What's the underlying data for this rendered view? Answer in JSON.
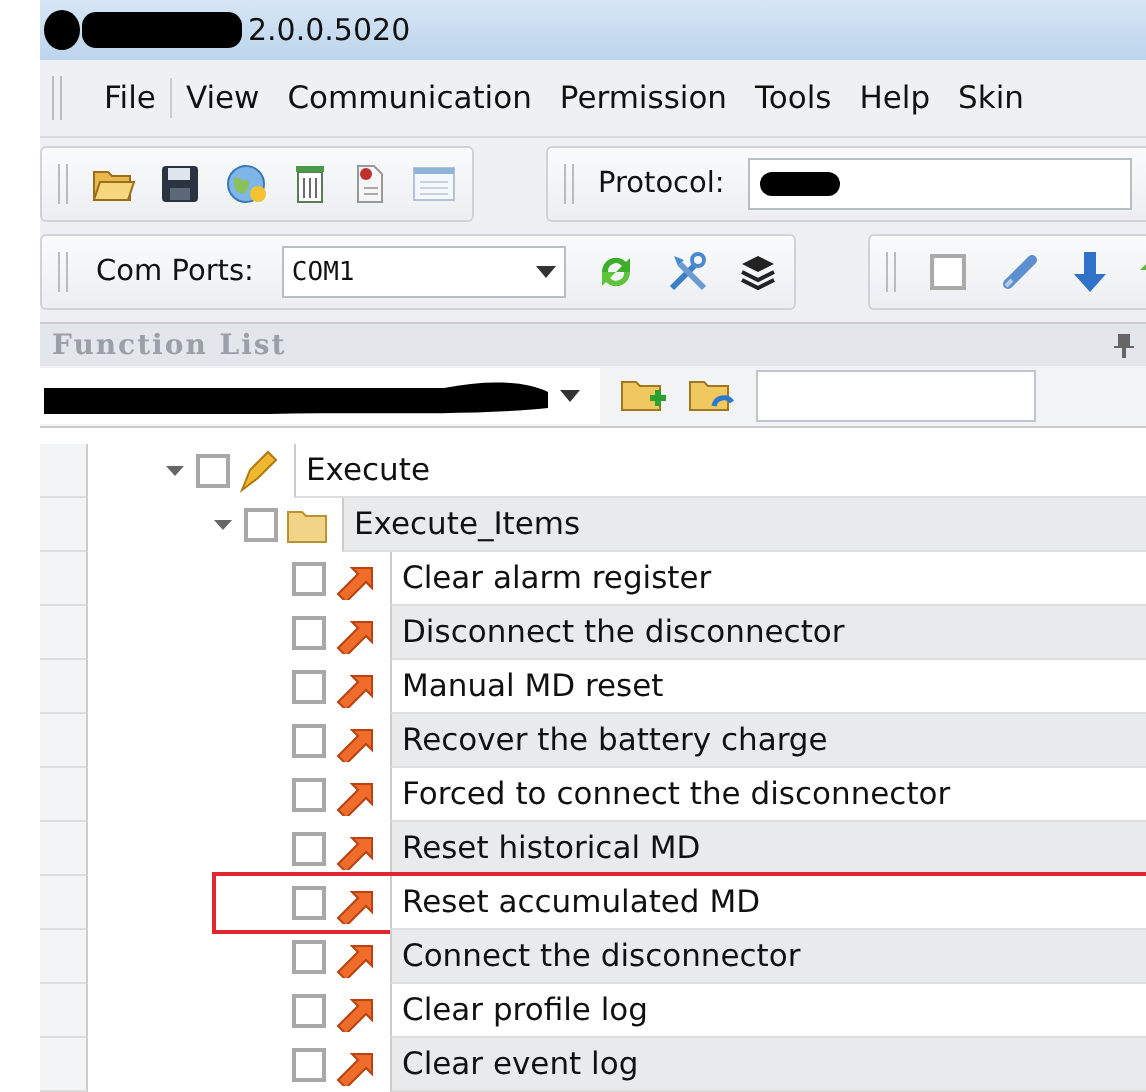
{
  "window": {
    "title": "2.0.0.5020"
  },
  "menu": [
    {
      "label": "File"
    },
    {
      "label": "View"
    },
    {
      "label": "Communication"
    },
    {
      "label": "Permission"
    },
    {
      "label": "Tools"
    },
    {
      "label": "Help"
    },
    {
      "label": "Skin"
    }
  ],
  "toolbar": {
    "protocol_label": "Protocol:",
    "com_ports_label": "Com Ports:",
    "com_port": "COM1"
  },
  "panel": {
    "title": "Function List",
    "tree": [
      {
        "label": "Execute",
        "kind": "group",
        "expanded": true,
        "checked": false,
        "highlighted": false,
        "children": [
          {
            "label": "Execute_Items",
            "kind": "folder",
            "expanded": true,
            "checked": false,
            "highlighted": false,
            "children": [
              {
                "label": "Clear alarm register",
                "kind": "command",
                "checked": false,
                "highlighted": false
              },
              {
                "label": "Disconnect the disconnector",
                "kind": "command",
                "checked": false,
                "highlighted": false
              },
              {
                "label": "Manual MD reset",
                "kind": "command",
                "checked": false,
                "highlighted": false
              },
              {
                "label": "Recover the battery charge",
                "kind": "command",
                "checked": false,
                "highlighted": false
              },
              {
                "label": "Forced to connect the disconnector",
                "kind": "command",
                "checked": false,
                "highlighted": false
              },
              {
                "label": "Reset historical MD",
                "kind": "command",
                "checked": false,
                "highlighted": false
              },
              {
                "label": "Reset accumulated MD",
                "kind": "command",
                "checked": false,
                "highlighted": true
              },
              {
                "label": "Connect the disconnector",
                "kind": "command",
                "checked": false,
                "highlighted": false
              },
              {
                "label": "Clear profile log",
                "kind": "command",
                "checked": false,
                "highlighted": false
              },
              {
                "label": "Clear event log",
                "kind": "command",
                "checked": false,
                "highlighted": false
              }
            ]
          }
        ]
      }
    ]
  }
}
